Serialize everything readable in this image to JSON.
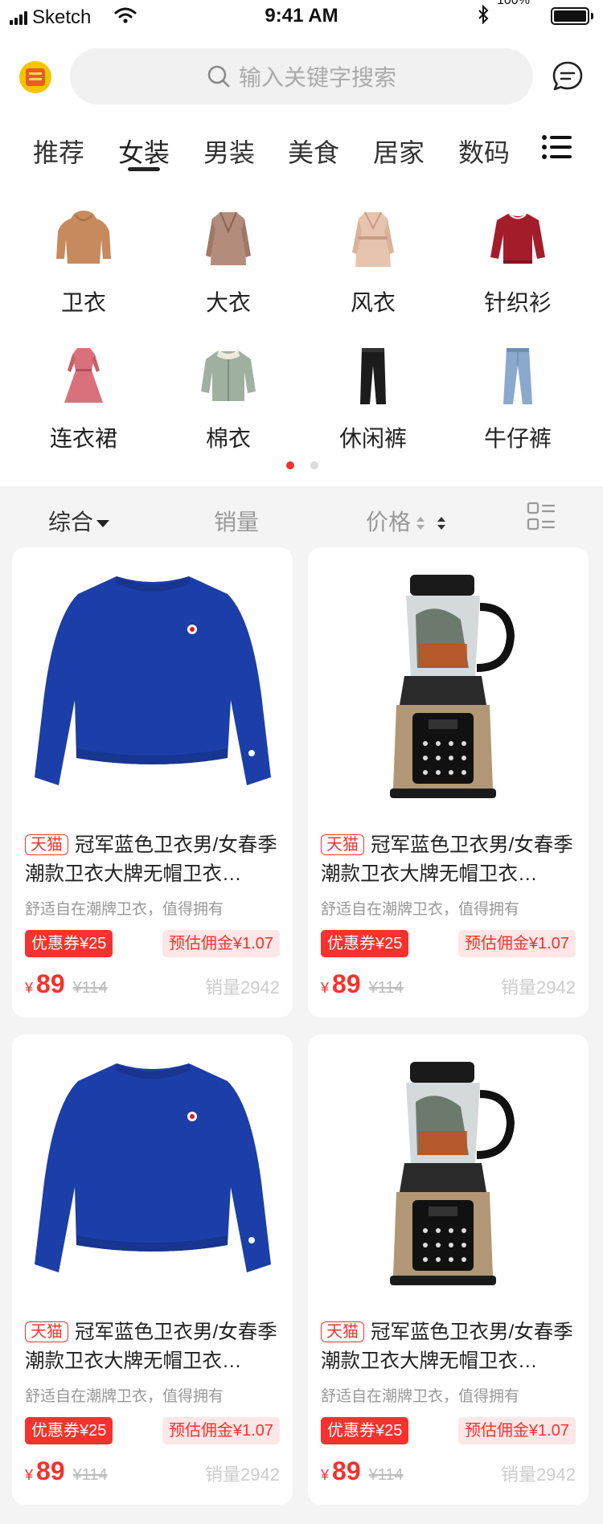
{
  "status_bar": {
    "carrier": "Sketch",
    "time": "9:41 AM",
    "battery_percent": "100%"
  },
  "header": {
    "search_placeholder": "输入关键字搜索"
  },
  "tabs": [
    "推荐",
    "女装",
    "男装",
    "美食",
    "居家",
    "数码"
  ],
  "active_tab": "女装",
  "categories": [
    {
      "label": "卫衣",
      "icon": "hoodie-icon"
    },
    {
      "label": "大衣",
      "icon": "coat-icon"
    },
    {
      "label": "风衣",
      "icon": "trench-coat-icon"
    },
    {
      "label": "针织衫",
      "icon": "sweater-icon"
    },
    {
      "label": "连衣裙",
      "icon": "dress-icon"
    },
    {
      "label": "棉衣",
      "icon": "padded-jacket-icon"
    },
    {
      "label": "休闲裤",
      "icon": "trousers-icon"
    },
    {
      "label": "牛仔裤",
      "icon": "jeans-icon"
    }
  ],
  "pagination": {
    "pages": 2,
    "active": 1
  },
  "filters": {
    "overall": "综合",
    "sales": "销量",
    "price": "价格"
  },
  "products": [
    {
      "image": "blue-sweatshirt",
      "tag": "天猫",
      "title": "冠军蓝色卫衣男/女春季潮款卫衣大牌无帽卫衣…",
      "subtitle": "舒适自在潮牌卫衣，值得拥有",
      "coupon": "优惠券¥25",
      "commission": "预估佣金¥1.07",
      "currency": "¥",
      "price": "89",
      "original_price": "¥114",
      "sales": "销量2942"
    },
    {
      "image": "blender",
      "tag": "天猫",
      "title": "冠军蓝色卫衣男/女春季潮款卫衣大牌无帽卫衣…",
      "subtitle": "舒适自在潮牌卫衣，值得拥有",
      "coupon": "优惠券¥25",
      "commission": "预估佣金¥1.07",
      "currency": "¥",
      "price": "89",
      "original_price": "¥114",
      "sales": "销量2942"
    },
    {
      "image": "blue-sweatshirt",
      "tag": "天猫",
      "title": "冠军蓝色卫衣男/女春季潮款卫衣大牌无帽卫衣…",
      "subtitle": "舒适自在潮牌卫衣，值得拥有",
      "coupon": "优惠券¥25",
      "commission": "预估佣金¥1.07",
      "currency": "¥",
      "price": "89",
      "original_price": "¥114",
      "sales": "销量2942"
    },
    {
      "image": "blender",
      "tag": "天猫",
      "title": "冠军蓝色卫衣男/女春季潮款卫衣大牌无帽卫衣…",
      "subtitle": "舒适自在潮牌卫衣，值得拥有",
      "coupon": "优惠券¥25",
      "commission": "预估佣金¥1.07",
      "currency": "¥",
      "price": "89",
      "original_price": "¥114",
      "sales": "销量2942"
    }
  ],
  "colors": {
    "accent": "#f5322d",
    "background": "#f4f4f4"
  }
}
